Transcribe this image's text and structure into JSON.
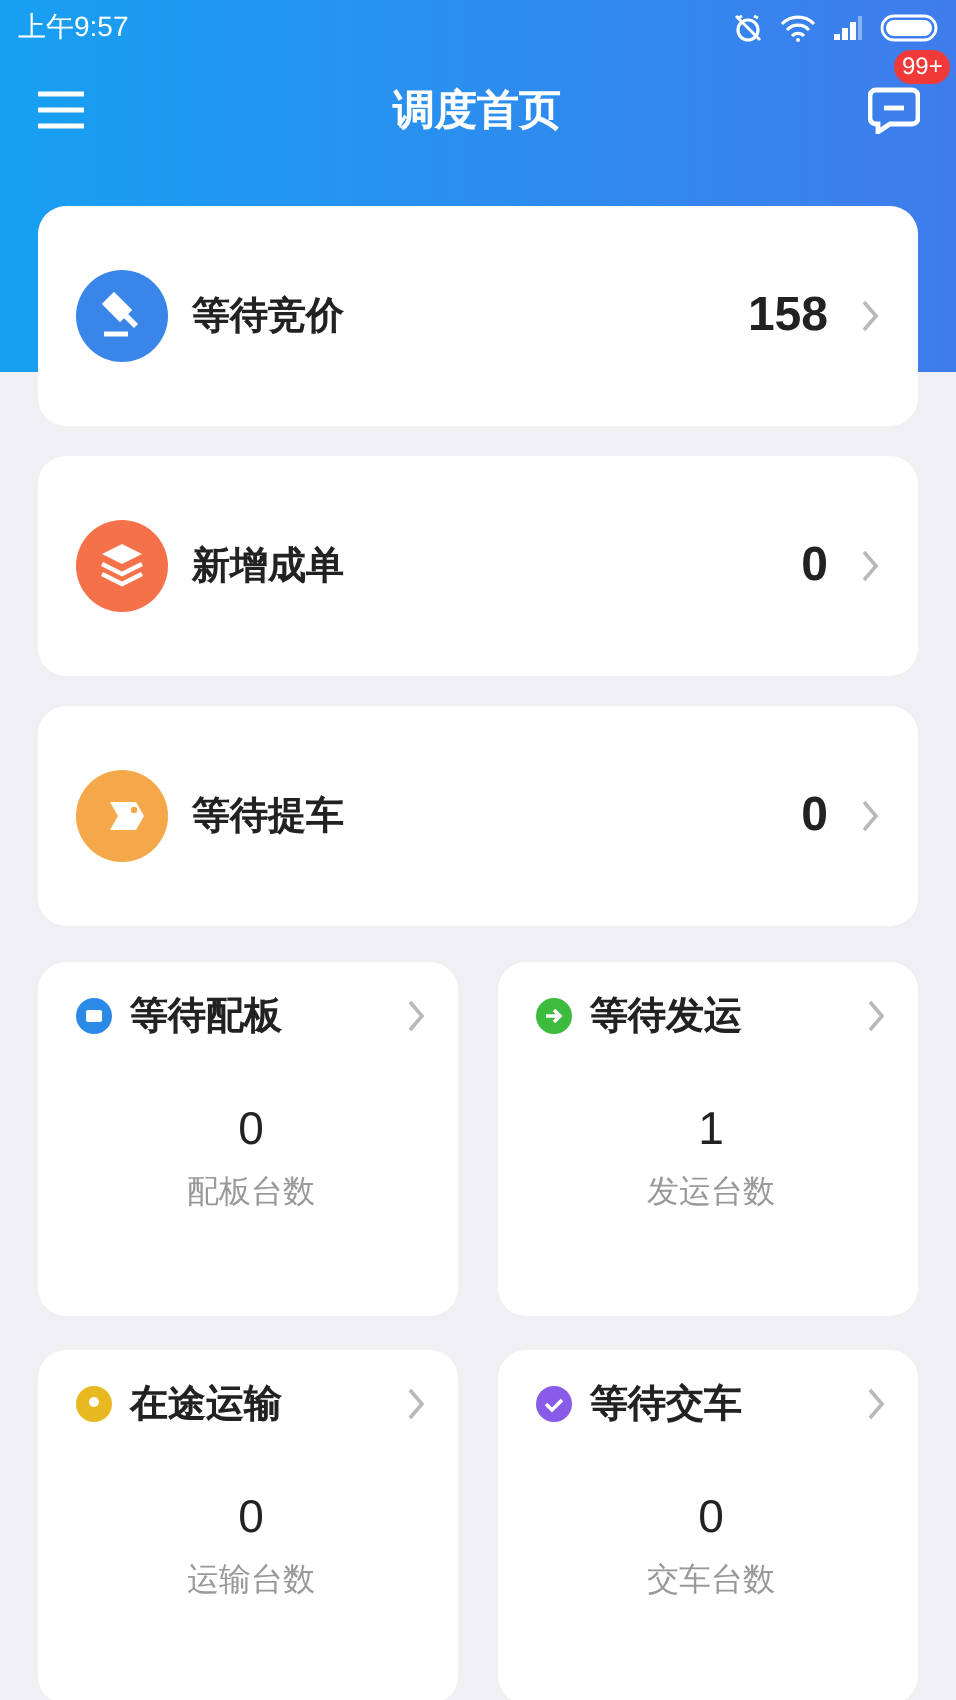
{
  "status_bar": {
    "time": "上午9:57"
  },
  "header": {
    "title": "调度首页",
    "badge": "99+"
  },
  "summary_cards": [
    {
      "label": "等待竞价",
      "count": "158",
      "kind": "gavel",
      "color": "#3a86e8"
    },
    {
      "label": "新增成单",
      "count": "0",
      "kind": "layers",
      "color": "#f5714a"
    },
    {
      "label": "等待提车",
      "count": "0",
      "kind": "tag",
      "color": "#f5a84a"
    }
  ],
  "stat_tiles": [
    {
      "title": "等待配板",
      "value": "0",
      "caption": "配板台数",
      "kind": "screen",
      "color": "#2a8ae8"
    },
    {
      "title": "等待发运",
      "value": "1",
      "caption": "发运台数",
      "kind": "arrow",
      "color": "#3dbb3d"
    },
    {
      "title": "在途运输",
      "value": "0",
      "caption": "运输台数",
      "kind": "pin",
      "color": "#e8b820"
    },
    {
      "title": "等待交车",
      "value": "0",
      "caption": "交车台数",
      "kind": "check",
      "color": "#8a5ae8"
    }
  ]
}
